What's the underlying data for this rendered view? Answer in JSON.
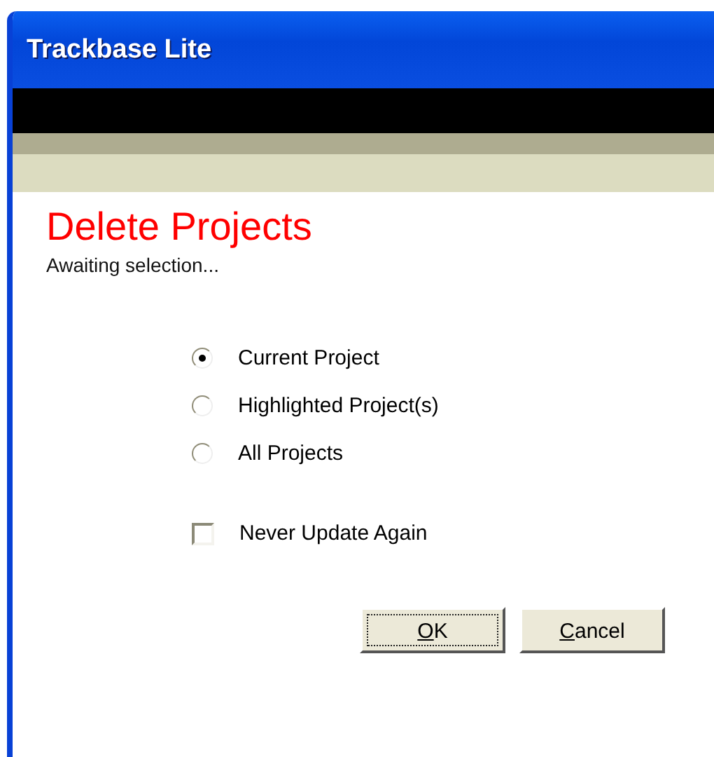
{
  "window": {
    "title": "Trackbase Lite"
  },
  "heading": "Delete Projects",
  "status": "Awaiting selection...",
  "options": [
    {
      "label": "Current Project",
      "selected": true
    },
    {
      "label": "Highlighted Project(s)",
      "selected": false
    },
    {
      "label": "All Projects",
      "selected": false
    }
  ],
  "never_update": {
    "label": "Never Update Again",
    "checked": false
  },
  "buttons": [
    {
      "label": "OK",
      "focused": true
    },
    {
      "label": "Cancel",
      "focused": false
    }
  ]
}
